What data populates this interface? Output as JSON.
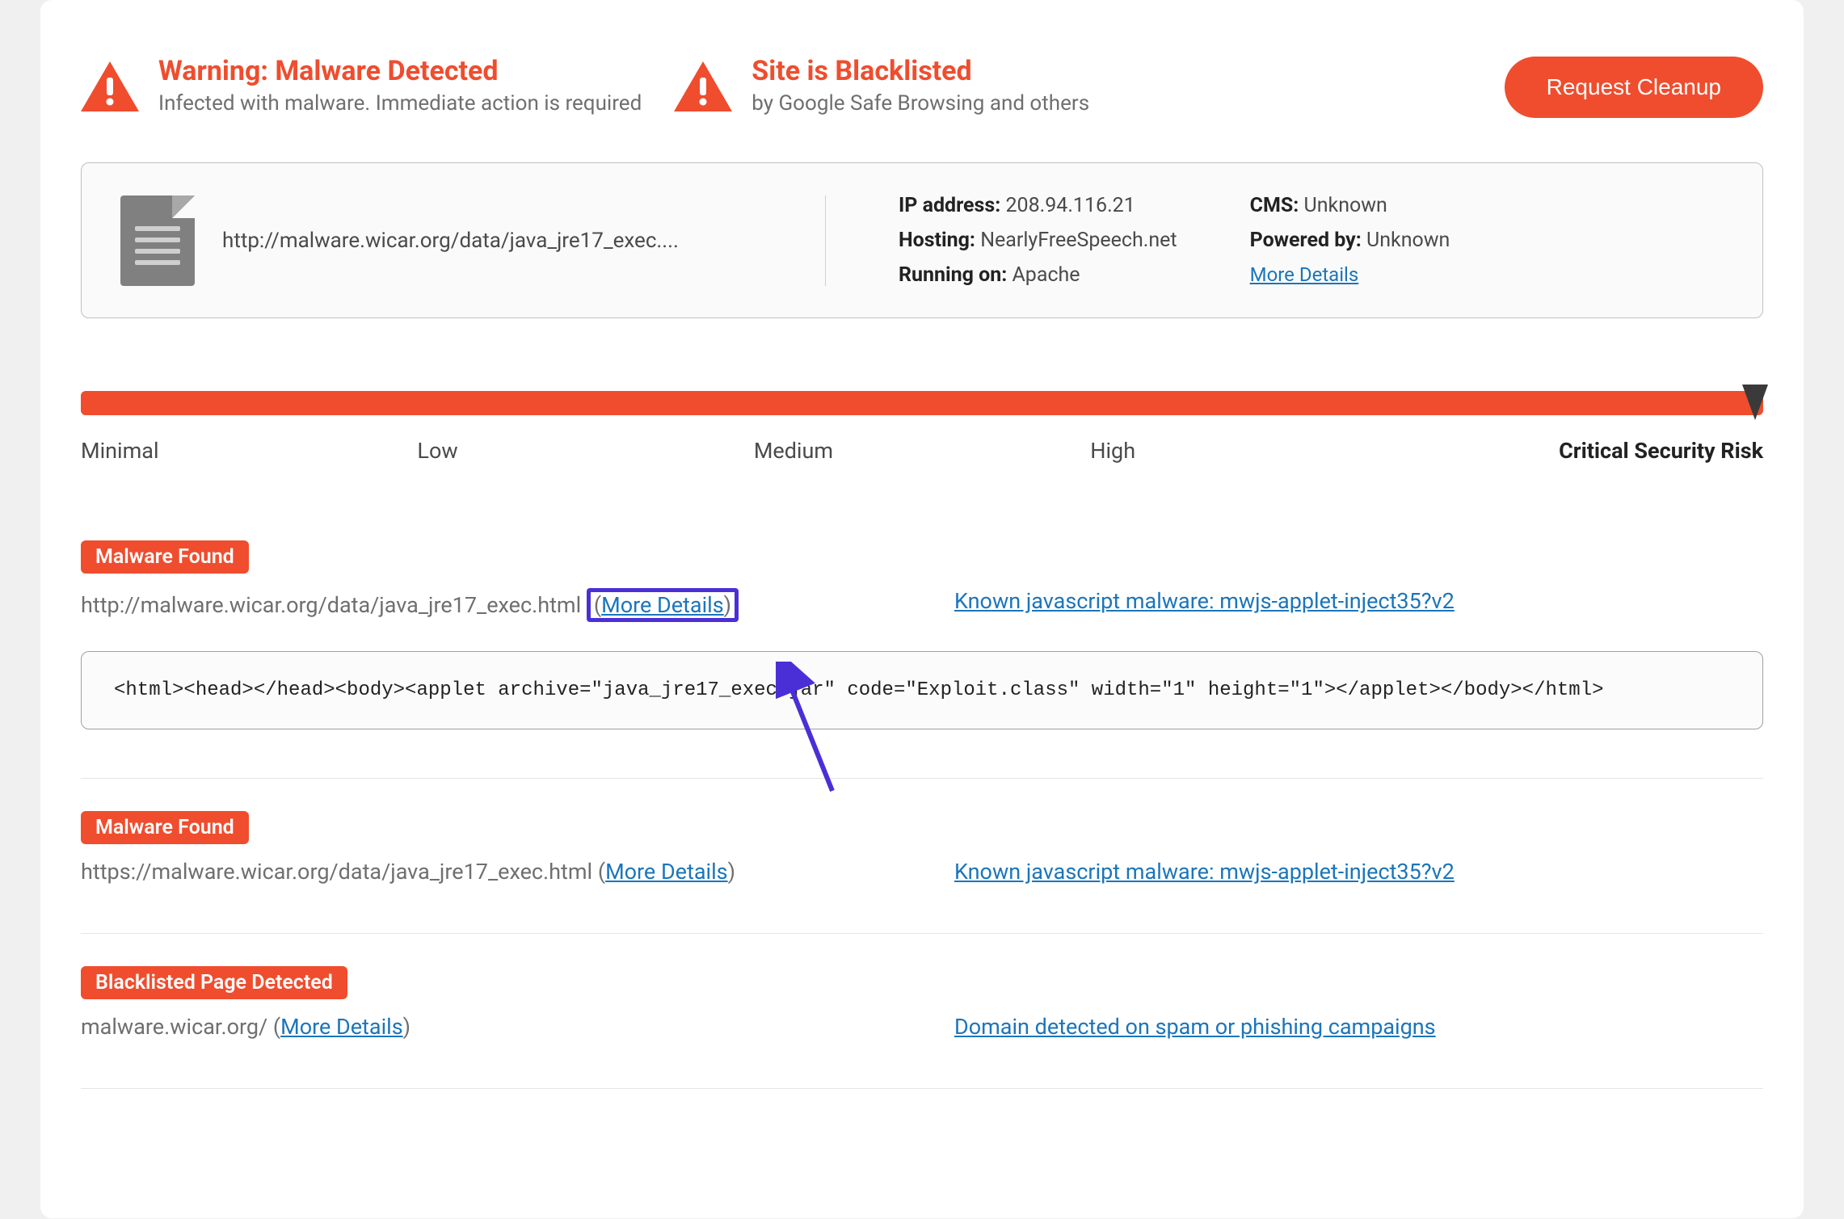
{
  "header": {
    "warning1_title": "Warning: Malware Detected",
    "warning1_sub": "Infected with malware. Immediate action is required",
    "warning2_title": "Site is Blacklisted",
    "warning2_sub": "by Google Safe Browsing and others",
    "cleanup_btn": "Request Cleanup"
  },
  "info": {
    "url": "http://malware.wicar.org/data/java_jre17_exec....",
    "ip_label": "IP address:",
    "ip_value": "208.94.116.21",
    "hosting_label": "Hosting:",
    "hosting_value": "NearlyFreeSpeech.net",
    "running_label": "Running on:",
    "running_value": "Apache",
    "cms_label": "CMS:",
    "cms_value": "Unknown",
    "powered_label": "Powered by:",
    "powered_value": "Unknown",
    "more_details": "More Details"
  },
  "risk": {
    "minimal": "Minimal",
    "low": "Low",
    "medium": "Medium",
    "high": "High",
    "critical": "Critical Security Risk"
  },
  "findings": [
    {
      "tag": "Malware Found",
      "url": "http://malware.wicar.org/data/java_jre17_exec.html",
      "more": "More Details",
      "threat": "Known javascript malware: mwjs-applet-inject35?v2",
      "code": "<html><head></head><body><applet archive=\"java_jre17_exec.jar\" code=\"Exploit.class\" width=\"1\" height=\"1\"></applet></body></html>",
      "highlight_more": true,
      "show_code": true
    },
    {
      "tag": "Malware Found",
      "url": "https://malware.wicar.org/data/java_jre17_exec.html",
      "more": "More Details",
      "threat": "Known javascript malware: mwjs-applet-inject35?v2",
      "highlight_more": false,
      "show_code": false
    },
    {
      "tag": "Blacklisted Page Detected",
      "url": "malware.wicar.org/",
      "more": "More Details",
      "threat": "Domain detected on spam or phishing campaigns",
      "highlight_more": false,
      "show_code": false
    }
  ]
}
